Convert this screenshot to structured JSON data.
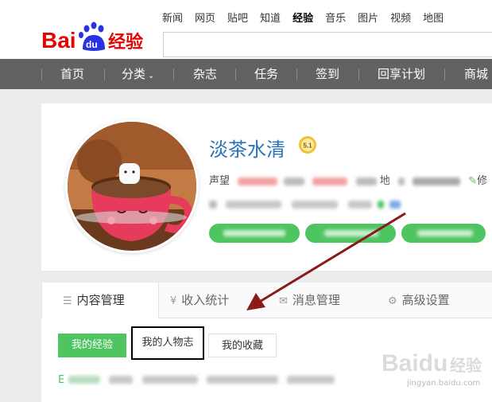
{
  "logo": {
    "brand": "Bai",
    "du": "du",
    "product": "经验"
  },
  "topnav": [
    "新闻",
    "网页",
    "贴吧",
    "知道",
    "经验",
    "音乐",
    "图片",
    "视频",
    "地图"
  ],
  "topnav_active": "经验",
  "navbar": [
    {
      "label": "首页"
    },
    {
      "label": "分类",
      "caret": "⌄"
    },
    {
      "label": "杂志"
    },
    {
      "label": "任务"
    },
    {
      "label": "签到"
    },
    {
      "label": "回享计划"
    },
    {
      "label": "商城"
    }
  ],
  "profile": {
    "username": "淡茶水清",
    "level_badge": "5.1",
    "reputation_label": "声望",
    "location_label": "地",
    "edit_label": "修"
  },
  "tabs": [
    {
      "icon": "☰",
      "label": "内容管理"
    },
    {
      "icon": "¥",
      "label": "收入统计"
    },
    {
      "icon": "✉",
      "label": "消息管理"
    },
    {
      "icon": "⚙",
      "label": "高级设置"
    }
  ],
  "subtabs": [
    "我的经验",
    "我的人物志",
    "我的收藏"
  ],
  "bottom_prefix": "E",
  "watermark": {
    "brand": "Baidu",
    "product": "经验",
    "url": "jingyan.baidu.com"
  },
  "colors": {
    "green": "#4fc561",
    "nav_bg": "#606264",
    "link_blue": "#2b73b7",
    "arrow": "#8b1a1a"
  }
}
